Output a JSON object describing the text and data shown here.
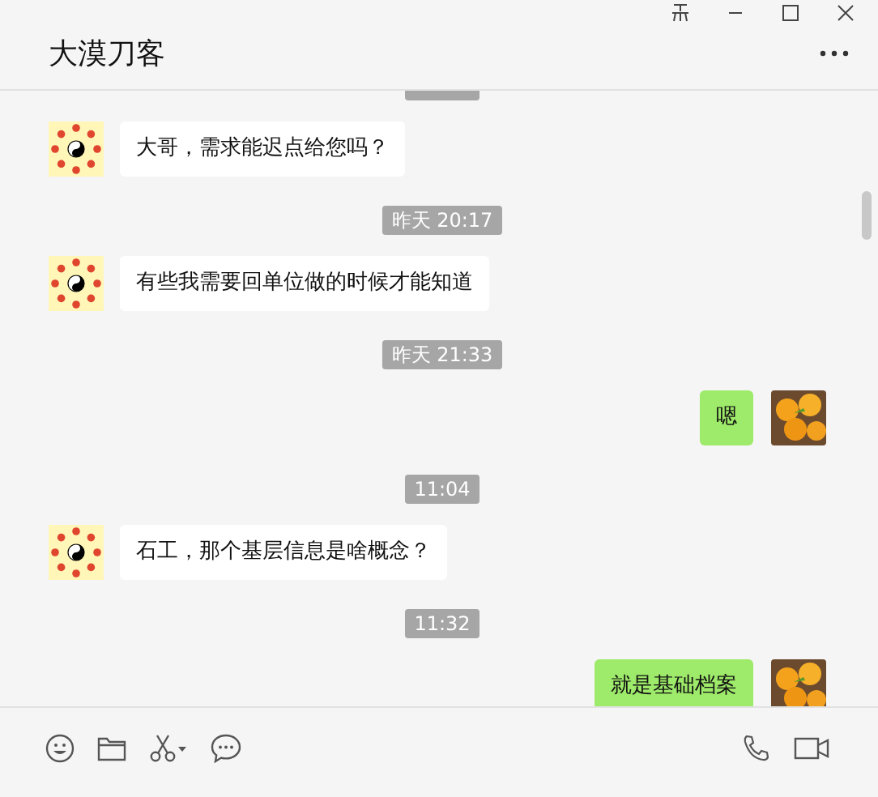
{
  "window": {
    "title": "大漠刀客"
  },
  "messages": [
    {
      "kind": "time-cut"
    },
    {
      "kind": "incoming",
      "text": "大哥，需求能迟点给您吗？"
    },
    {
      "kind": "time",
      "text": "昨天 20:17"
    },
    {
      "kind": "incoming",
      "text": "有些我需要回单位做的时候才能知道"
    },
    {
      "kind": "time",
      "text": "昨天 21:33"
    },
    {
      "kind": "outgoing",
      "text": "嗯"
    },
    {
      "kind": "time",
      "text": "11:04"
    },
    {
      "kind": "incoming",
      "text": "石工，那个基层信息是啥概念？"
    },
    {
      "kind": "time",
      "text": "11:32"
    },
    {
      "kind": "outgoing",
      "text": "就是基础档案"
    }
  ]
}
